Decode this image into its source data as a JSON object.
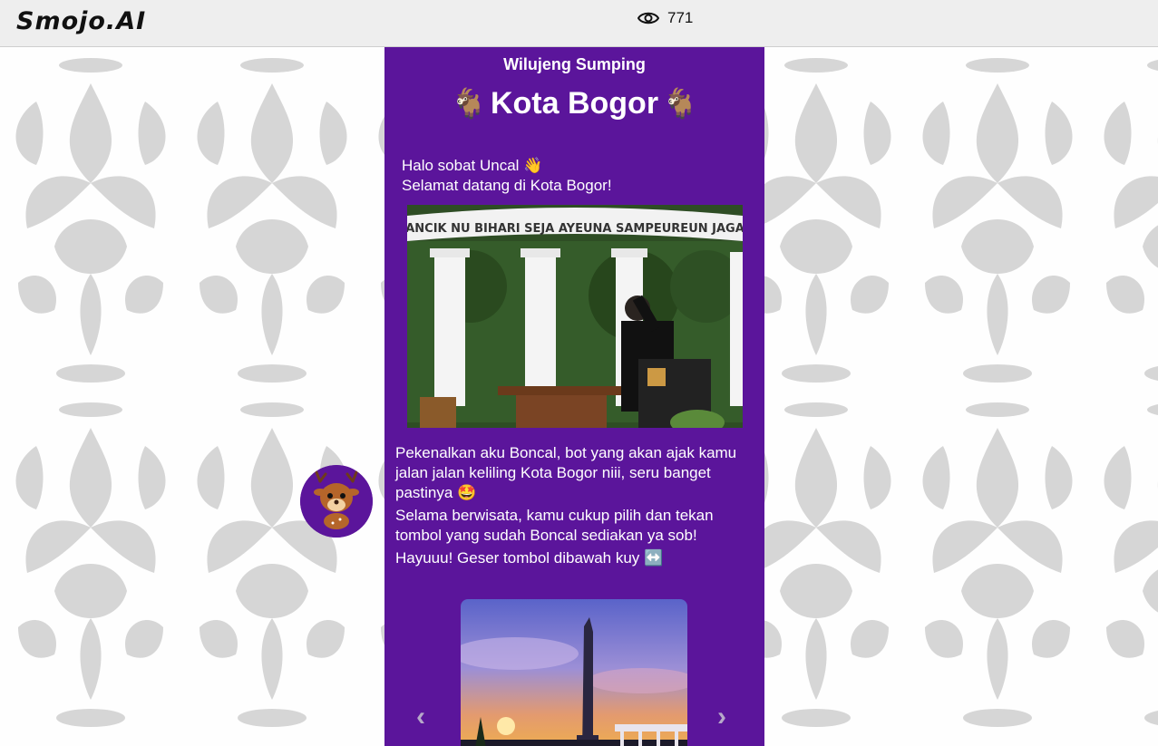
{
  "header": {
    "logo_text": "Smojo.AI",
    "view_count": "771"
  },
  "panel": {
    "greeting": "Wilujeng Sumping",
    "title": "Kota Bogor",
    "title_emoji": "🐐",
    "intro_line1": "Halo sobat Uncal 👋",
    "intro_line2": "Selamat datang di Kota Bogor!",
    "photo_banner": "ANCIK NU BIHARI SEJA AYEUNA SAMPEUREUN JAGA",
    "bot_paragraph1": "Pekenalkan aku Boncal, bot yang akan ajak kamu jalan jalan keliling Kota Bogor niii, seru banget pastinya 🤩",
    "bot_paragraph2": "Selama berwisata, kamu cukup pilih dan tekan tombol yang sudah Boncal sediakan ya sob!",
    "bot_paragraph3": "Hayuuu! Geser tombol dibawah kuy ↔️",
    "carousel_prev": "‹",
    "carousel_next": "›"
  },
  "colors": {
    "panel_bg": "#5b159b",
    "topbar_bg": "#eeeeee",
    "damask_color": "#d6d6d6"
  },
  "icons": {
    "views": "eye-icon",
    "avatar": "deer-mascot-icon"
  }
}
